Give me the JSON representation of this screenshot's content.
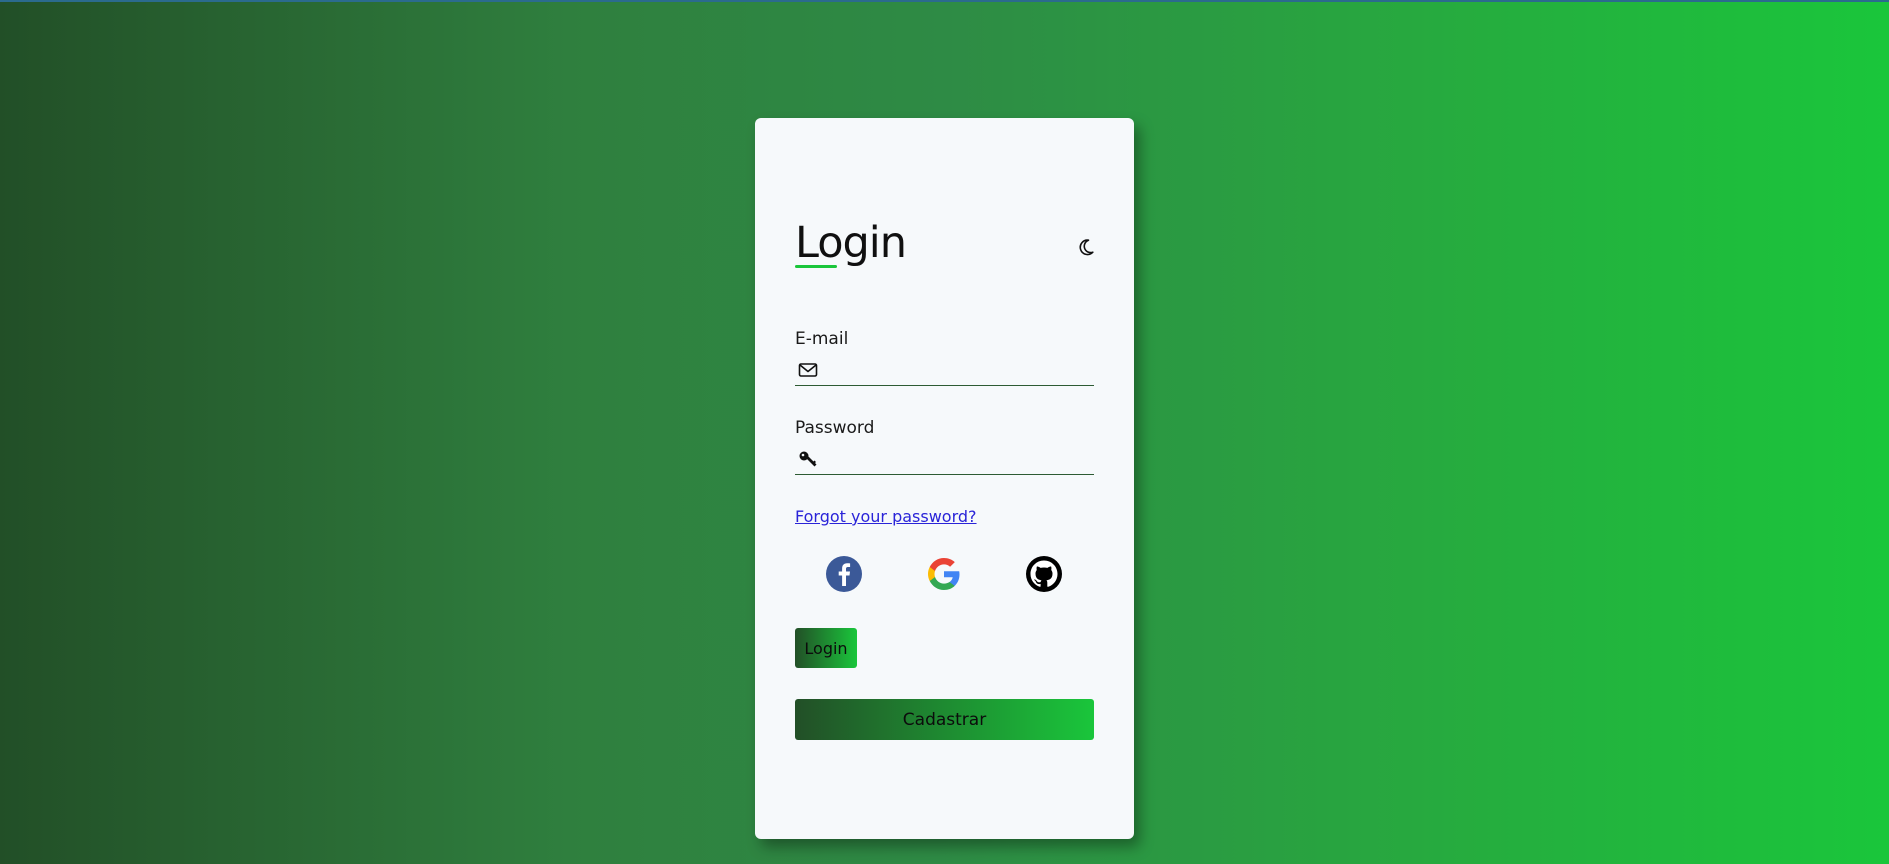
{
  "page": {
    "title": "Login",
    "colors": {
      "gradient_start": "#224f27",
      "gradient_end": "#1ac63b",
      "card_background": "#f6f9fb",
      "link": "#2a24d8",
      "accent_underline": "#1ac63b"
    }
  },
  "header": {
    "title": "Login",
    "theme_toggle_icon": "moon-icon"
  },
  "form": {
    "email": {
      "label": "E-mail",
      "icon": "envelope-icon",
      "value": "",
      "placeholder": ""
    },
    "password": {
      "label": "Password",
      "icon": "key-icon",
      "value": "",
      "placeholder": ""
    },
    "forgot_link": "Forgot your password?"
  },
  "social": {
    "providers": [
      {
        "name": "facebook",
        "icon": "facebook-icon",
        "color": "#3b5998"
      },
      {
        "name": "google",
        "icon": "google-icon",
        "color": "#4285f4"
      },
      {
        "name": "github",
        "icon": "github-icon",
        "color": "#000000"
      }
    ]
  },
  "buttons": {
    "login_label": "Login",
    "register_label": "Cadastrar"
  }
}
